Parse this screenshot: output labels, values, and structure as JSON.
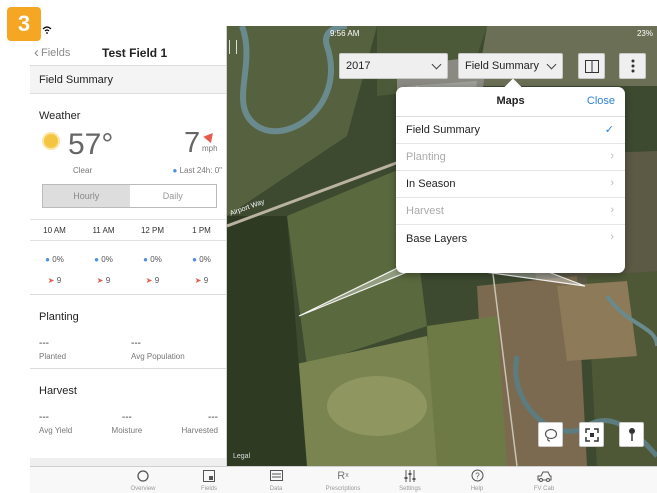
{
  "badge": "3",
  "status": {
    "time": "9:56 AM",
    "battery": "23%"
  },
  "nav": {
    "back_label": "Fields",
    "title": "Test Field 1"
  },
  "panel": {
    "section_header": "Field Summary",
    "weather": {
      "title": "Weather",
      "temperature": "57°",
      "condition": "Clear",
      "wind_speed": "7",
      "wind_unit": "mph",
      "rain_24h": "Last 24h: 0\"",
      "tabs": [
        "Hourly",
        "Daily"
      ],
      "active_tab": "Hourly",
      "hours": [
        {
          "time": "10 AM",
          "rain": "0%",
          "wind": "9"
        },
        {
          "time": "11 AM",
          "rain": "0%",
          "wind": "9"
        },
        {
          "time": "12 PM",
          "rain": "0%",
          "wind": "9"
        },
        {
          "time": "1 PM",
          "rain": "0%",
          "wind": "9"
        }
      ]
    },
    "planting": {
      "title": "Planting",
      "stats": [
        {
          "value": "---",
          "label": "Planted"
        },
        {
          "value": "---",
          "label": "Avg Population"
        }
      ]
    },
    "harvest": {
      "title": "Harvest",
      "stats": [
        {
          "value": "---",
          "label": "Avg Yield"
        },
        {
          "value": "---",
          "label": "Moisture"
        },
        {
          "value": "---",
          "label": "Harvested"
        }
      ]
    }
  },
  "map": {
    "year_select": "2017",
    "layer_select": "Field Summary",
    "road_label": "Airport Way",
    "legal": "Legal",
    "popover": {
      "title": "Maps",
      "close": "Close",
      "items": [
        {
          "label": "Field Summary",
          "state": "checked"
        },
        {
          "label": "Planting",
          "state": "disabled"
        },
        {
          "label": "In Season",
          "state": "enabled"
        },
        {
          "label": "Harvest",
          "state": "disabled"
        },
        {
          "label": "Base Layers",
          "state": "enabled"
        }
      ]
    }
  },
  "tabbar": [
    {
      "label": "Overview",
      "icon": "overview-icon"
    },
    {
      "label": "Fields",
      "icon": "fields-icon"
    },
    {
      "label": "Data",
      "icon": "data-icon"
    },
    {
      "label": "Prescriptions",
      "icon": "prescriptions-icon"
    },
    {
      "label": "Settings",
      "icon": "settings-icon"
    },
    {
      "label": "Help",
      "icon": "help-icon"
    },
    {
      "label": "FV Cab",
      "icon": "fv-cab-icon"
    }
  ],
  "colors": {
    "accent": "#2f7fd6",
    "badge": "#f5a623",
    "wind": "#e85a4f",
    "rain": "#4a90d9"
  }
}
